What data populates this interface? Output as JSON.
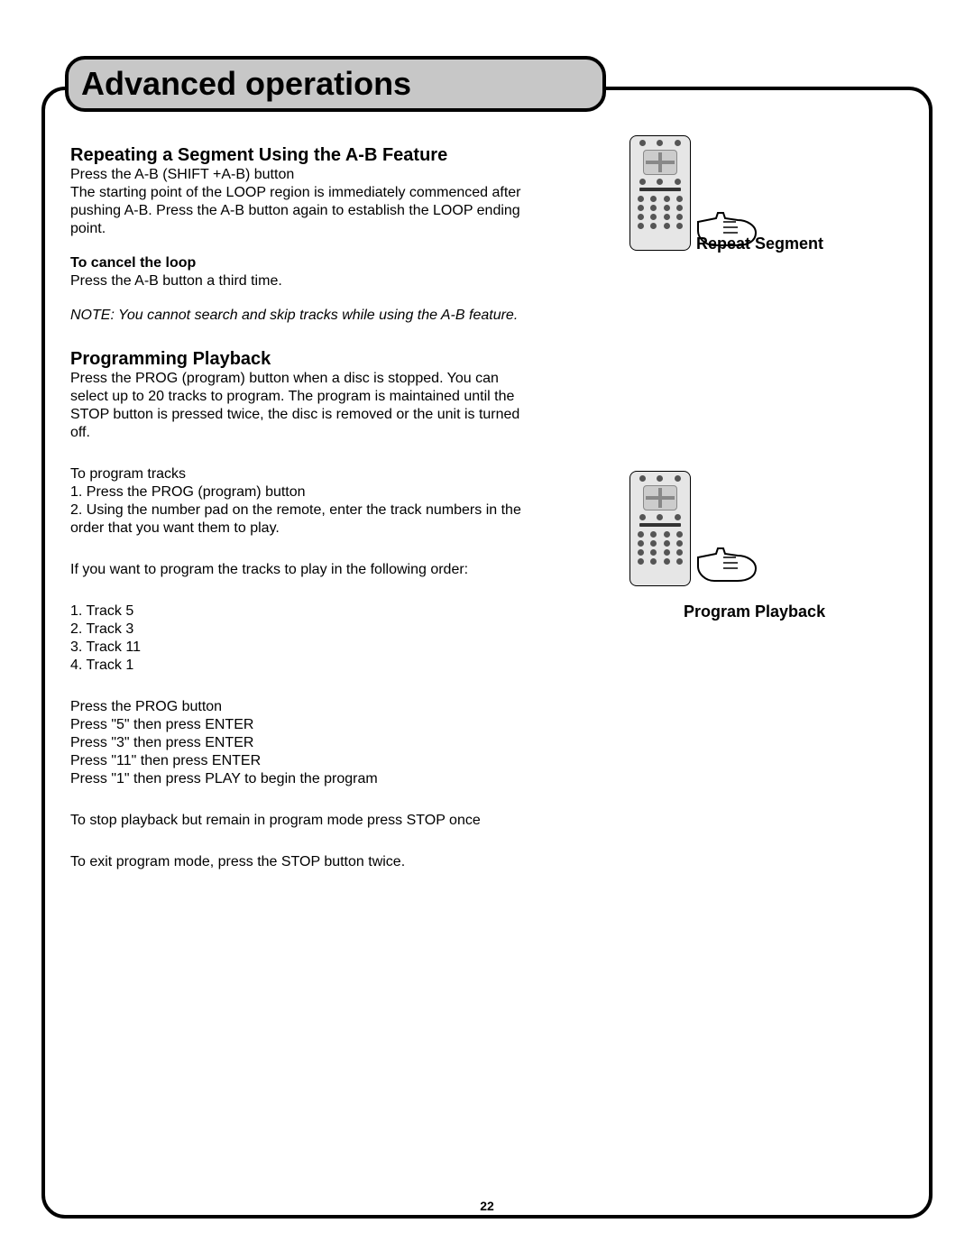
{
  "header": {
    "title": "Advanced operations"
  },
  "page_number": "22",
  "left": {
    "h_ab": "Repeating a Segment Using the A-B Feature",
    "ab_p1": "Press the A-B (SHIFT +A-B) button",
    "ab_p2": "The starting point of the LOOP region is immediately commenced after pushing A-B.  Press the A-B button again to establish the LOOP ending point.",
    "cancel_h": "To cancel the loop",
    "cancel_p": "Press the A-B button a third time.",
    "note": "NOTE: You cannot search and skip tracks while using the A-B feature.",
    "h_prog": "Programming Playback",
    "prog_p1": "Press the PROG (program) button when a disc is stopped. You can select up to 20 tracks to program. The program is maintained until the STOP button is pressed twice, the disc is removed or the unit is turned off.",
    "prog_steps_intro": "To program tracks",
    "prog_step1": "1. Press the PROG (program) button",
    "prog_step2": "2. Using the number pad on the remote, enter the track numbers in the order that you want them to play.",
    "prog_order_intro": "If you want to program the tracks to play in the following order:",
    "order1": "1. Track 5",
    "order2": "2. Track 3",
    "order3": "3. Track 11",
    "order4": "4. Track 1",
    "press1": "Press the PROG button",
    "press2": "Press \"5\" then press ENTER",
    "press3": "Press \"3\" then press ENTER",
    "press4": "Press \"11\" then press ENTER",
    "press5": "Press \"1\" then press PLAY to begin the program",
    "stop_once": "To stop playback but remain in program mode press STOP once",
    "stop_twice": "To exit program mode, press the STOP button twice."
  },
  "right": {
    "caption_repeat": "Repeat Segment",
    "caption_program": "Program Playback"
  }
}
